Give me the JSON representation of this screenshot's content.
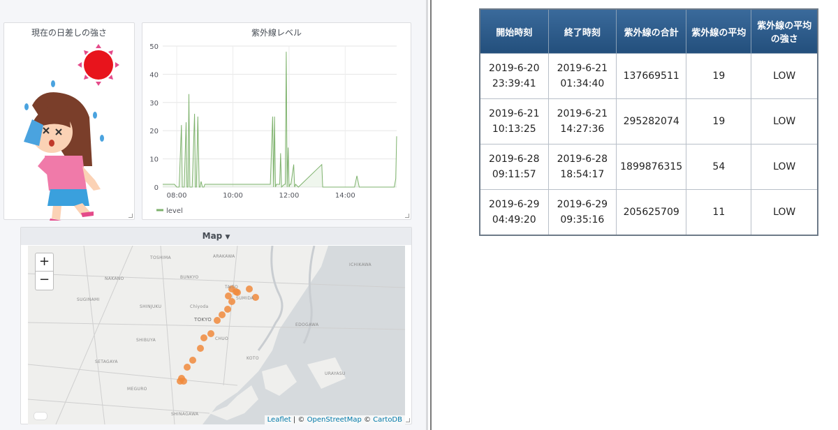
{
  "panels": {
    "sunlight_title": "現在の日差しの強さ",
    "uv_title": "紫外線レベル",
    "map_title": "Map"
  },
  "chart_data": {
    "type": "line",
    "title": "紫外線レベル",
    "x_ticks": [
      "08:00",
      "10:00",
      "12:00",
      "14:00"
    ],
    "y_ticks": [
      "0",
      "10",
      "20",
      "30",
      "40",
      "50"
    ],
    "ylim": [
      0,
      50
    ],
    "xlim": [
      "07:30",
      "15:50"
    ],
    "legend": "bottom-left",
    "series": [
      {
        "name": "level",
        "color": "#7eb26d",
        "x": [
          "07:30",
          "07:55",
          "08:00",
          "08:05",
          "08:10",
          "08:12",
          "08:16",
          "08:20",
          "08:22",
          "08:24",
          "08:26",
          "08:28",
          "08:33",
          "08:38",
          "08:40",
          "08:42",
          "08:45",
          "08:48",
          "08:50",
          "08:52",
          "08:55",
          "08:58",
          "09:00",
          "09:05",
          "11:20",
          "11:25",
          "11:27",
          "11:29",
          "11:31",
          "11:33",
          "11:40",
          "11:42",
          "11:44",
          "11:50",
          "11:52",
          "11:54",
          "11:56",
          "11:58",
          "12:00",
          "12:02",
          "12:04",
          "12:10",
          "12:12",
          "12:14",
          "12:20",
          "13:10",
          "13:12",
          "13:20",
          "14:20",
          "14:25",
          "14:30",
          "15:45",
          "15:48",
          "15:50"
        ],
        "y": [
          1,
          1,
          0,
          0,
          22,
          0,
          0,
          23,
          0,
          0,
          33,
          0,
          0,
          26,
          0,
          0,
          25,
          0,
          0,
          2,
          0,
          0,
          1,
          1,
          1,
          25,
          0,
          25,
          0,
          1,
          1,
          12,
          0,
          1,
          1,
          48,
          0,
          14,
          0,
          1,
          1,
          8,
          0,
          1,
          0,
          8,
          0,
          0,
          0,
          4,
          0,
          0,
          3,
          18
        ]
      }
    ]
  },
  "map": {
    "zoom_in": "+",
    "zoom_out": "−",
    "areas": [
      "TOSHIMA",
      "ARAKAWA",
      "ICHIKAWA",
      "NAKANO",
      "BUNKYO",
      "TAITO",
      "SUGINAMI",
      "SHINJUKU",
      "Chiyoda",
      "SUMIDA",
      "TOKYO",
      "EDOGAWA",
      "SHIBUYA",
      "CHUO",
      "SETAGAYA",
      "KOTO",
      "URAYASU",
      "MEGURO",
      "SHINAGAWA"
    ],
    "attribution": {
      "leaflet": "Leaflet",
      "sep": " | © ",
      "osm": "OpenStreetMap",
      "sep2": " © ",
      "carto": "CartoDB"
    }
  },
  "table": {
    "headers": [
      "開始時刻",
      "終了時刻",
      "紫外線の合計",
      "紫外線の平均",
      "紫外線の平均の強さ"
    ],
    "rows": [
      {
        "start_date": "2019-6-20",
        "start_time": "23:39:41",
        "end_date": "2019-6-21",
        "end_time": "01:34:40",
        "total": "137669511",
        "avg": "19",
        "level": "LOW"
      },
      {
        "start_date": "2019-6-21",
        "start_time": "10:13:25",
        "end_date": "2019-6-21",
        "end_time": "14:27:36",
        "total": "295282074",
        "avg": "19",
        "level": "LOW"
      },
      {
        "start_date": "2019-6-28",
        "start_time": "09:11:57",
        "end_date": "2019-6-28",
        "end_time": "18:54:17",
        "total": "1899876315",
        "avg": "54",
        "level": "LOW"
      },
      {
        "start_date": "2019-6-29",
        "start_time": "04:49:20",
        "end_date": "2019-6-29",
        "end_time": "09:35:16",
        "total": "205625709",
        "avg": "11",
        "level": "LOW"
      }
    ]
  },
  "colors": {
    "route": "#f08a3c",
    "sun": "#e8141c",
    "series": "#7eb26d"
  }
}
